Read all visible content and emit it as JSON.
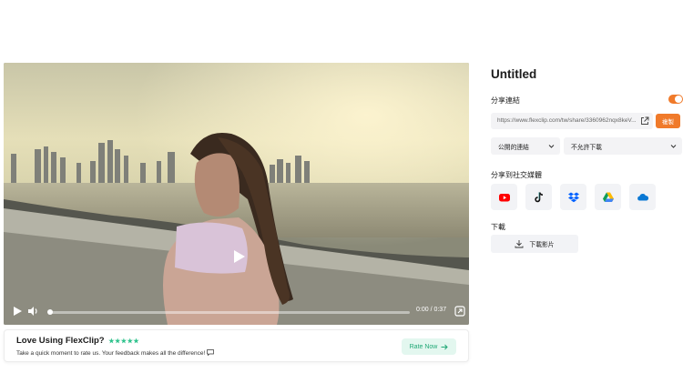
{
  "video": {
    "time_display": "0:00 / 0:37",
    "progress": 0
  },
  "rating": {
    "title": "Love Using FlexClip?",
    "stars": "★★★★★",
    "subtitle": "Take a quick moment to rate us. Your feedback makes all the difference!",
    "button_label": "Rate Now"
  },
  "panel": {
    "title": "Untitled",
    "share_link_label": "分享連結",
    "share_toggle_on": true,
    "url": "https://www.flexclip.com/tw/share/3360962nqx8keV...",
    "copy_label": "複製",
    "visibility_select": "公開的連結",
    "download_permission_select": "不允許下載",
    "social_label": "分享到社交媒體",
    "social": [
      {
        "name": "youtube-icon",
        "color": "#ff0000"
      },
      {
        "name": "tiktok-icon",
        "color": "#111111"
      },
      {
        "name": "dropbox-icon",
        "color": "#0061ff"
      },
      {
        "name": "google-drive-icon",
        "color": "#1fa463"
      },
      {
        "name": "onedrive-icon",
        "color": "#0a78d4"
      }
    ],
    "download_label": "下載",
    "download_button": "下載影片"
  },
  "colors": {
    "accent": "#f07a2a",
    "rate_green": "#21a876"
  }
}
